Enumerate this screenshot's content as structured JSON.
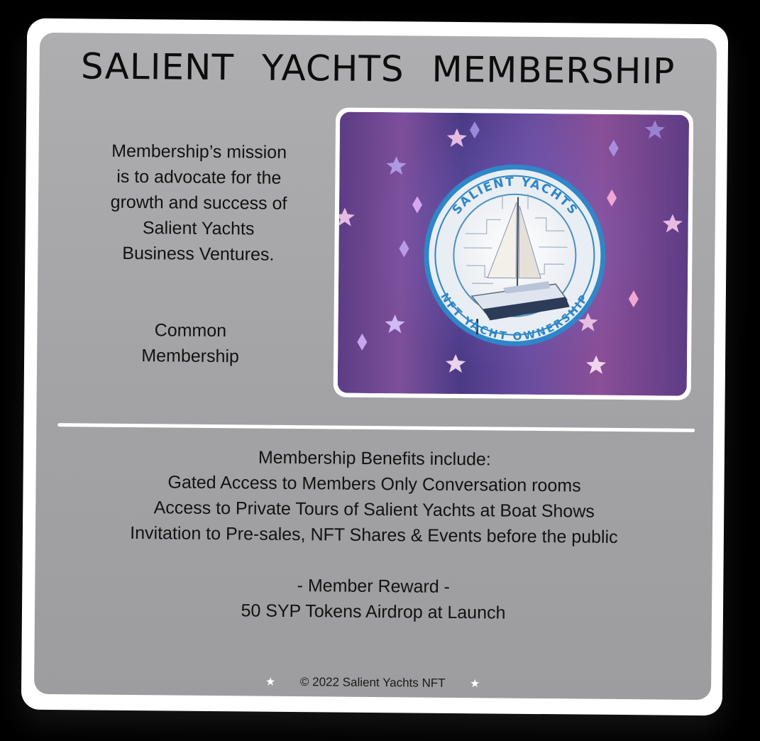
{
  "header": {
    "title": "SALIENT  YACHTS  MEMBERSHIP"
  },
  "mission": {
    "lines": [
      "Membership’s mission",
      "is to advocate for the",
      "growth and success of",
      "Salient Yachts",
      "Business Ventures."
    ]
  },
  "tier": {
    "lines": [
      "Common",
      "Membership"
    ]
  },
  "badge": {
    "top_text": "SALIENT YACHTS",
    "bottom_text": "NFT YACHT OWNERSHIP"
  },
  "benefits": {
    "lines": [
      "Membership Benefits include:",
      "Gated Access to Members Only Conversation rooms",
      "Access to Private Tours of Salient Yachts at Boat Shows",
      "Invitation to Pre-sales, NFT Shares & Events before the public"
    ]
  },
  "reward": {
    "heading": "- Member Reward -",
    "detail": "50 SYP Tokens Airdrop at Launch"
  },
  "footer": {
    "copyright": "© 2022 Salient Yachts NFT"
  },
  "icons": {
    "decor": "star-icon"
  },
  "colors": {
    "card": "#a6a6a8",
    "frame": "#ffffff",
    "badge_ring": "#2f86c8"
  }
}
